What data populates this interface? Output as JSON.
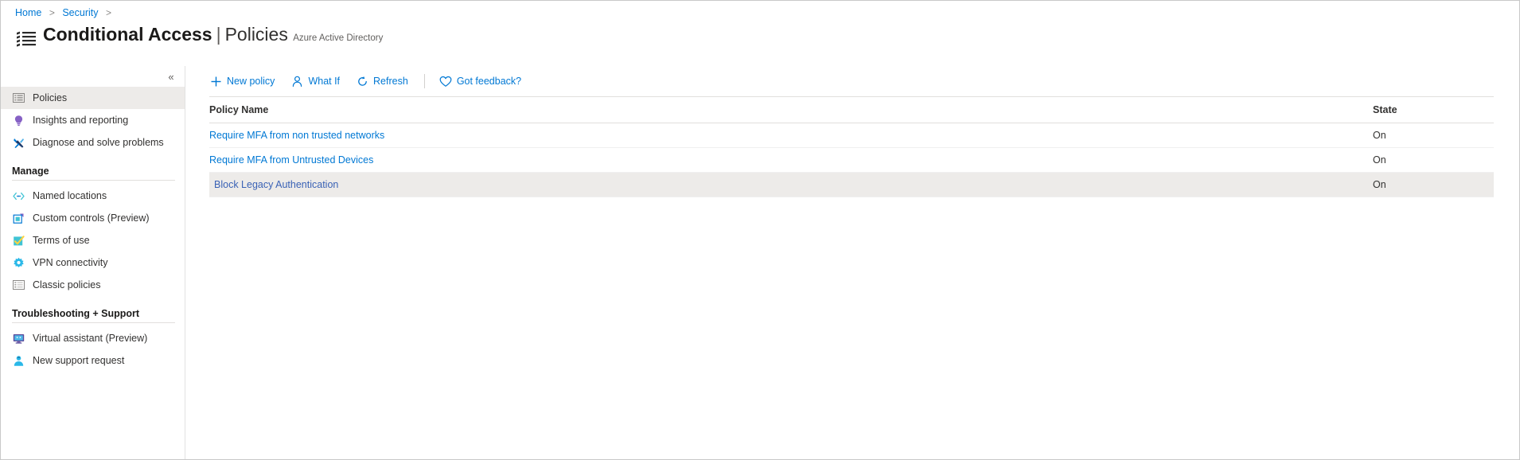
{
  "breadcrumb": {
    "items": [
      {
        "label": "Home"
      },
      {
        "label": "Security"
      }
    ],
    "separator": ">"
  },
  "header": {
    "icon": "list-bullets-icon",
    "title_main": "Conditional Access",
    "title_separator": "|",
    "title_sub": "Policies",
    "subtitle": "Azure Active Directory"
  },
  "sidebar": {
    "collapse_label": "«",
    "items": [
      {
        "label": "Policies",
        "icon": "list-icon",
        "selected": true
      },
      {
        "label": "Insights and reporting",
        "icon": "lightbulb-icon",
        "selected": false
      },
      {
        "label": "Diagnose and solve problems",
        "icon": "wrench-cross-icon",
        "selected": false
      }
    ],
    "groups": [
      {
        "title": "Manage",
        "items": [
          {
            "label": "Named locations",
            "icon": "code-brackets-icon"
          },
          {
            "label": "Custom controls (Preview)",
            "icon": "square-overlay-icon"
          },
          {
            "label": "Terms of use",
            "icon": "checkbox-checked-icon"
          },
          {
            "label": "VPN connectivity",
            "icon": "gear-icon"
          },
          {
            "label": "Classic policies",
            "icon": "list-icon"
          }
        ]
      },
      {
        "title": "Troubleshooting + Support",
        "items": [
          {
            "label": "Virtual assistant (Preview)",
            "icon": "monitor-assistant-icon"
          },
          {
            "label": "New support request",
            "icon": "person-support-icon"
          }
        ]
      }
    ]
  },
  "toolbar": {
    "buttons": [
      {
        "label": "New policy",
        "icon": "plus-icon"
      },
      {
        "label": "What If",
        "icon": "person-icon"
      },
      {
        "label": "Refresh",
        "icon": "refresh-icon"
      },
      {
        "label": "Got feedback?",
        "icon": "heart-icon"
      }
    ]
  },
  "table": {
    "columns": [
      {
        "label": "Policy Name"
      },
      {
        "label": "State"
      }
    ],
    "rows": [
      {
        "name": "Require MFA from non trusted networks",
        "state": "On",
        "highlight": false
      },
      {
        "name": "Require MFA from Untrusted Devices",
        "state": "On",
        "highlight": false
      },
      {
        "name": "Block Legacy Authentication",
        "state": "On",
        "highlight": true
      }
    ]
  },
  "colors": {
    "link": "#0078d4",
    "selected_row": "#edebe9",
    "text": "#323130",
    "purple": "#8661c5",
    "teal": "#40c4d4"
  }
}
